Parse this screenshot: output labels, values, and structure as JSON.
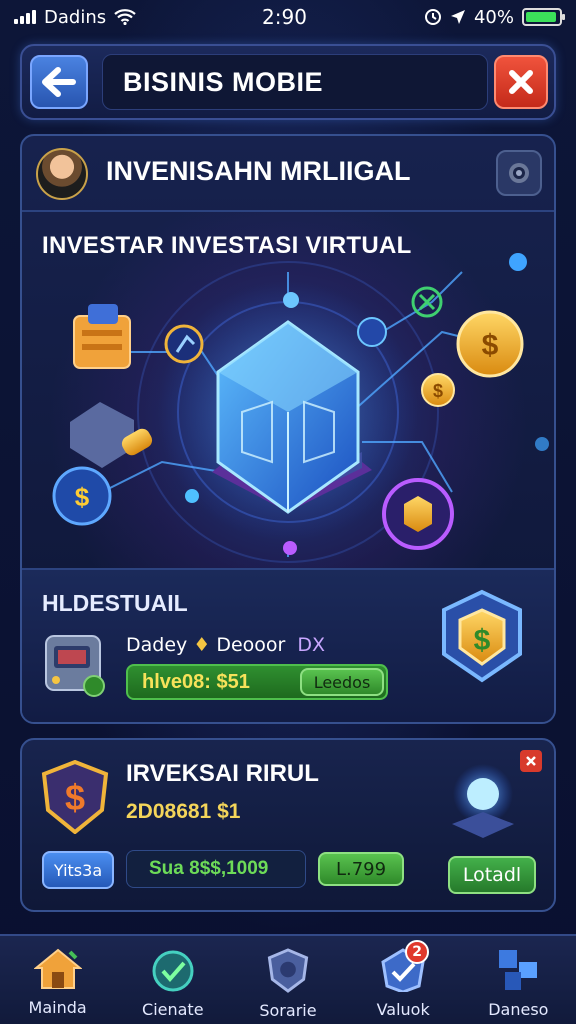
{
  "status_bar": {
    "carrier": "Dadins",
    "time": "2:90",
    "battery": "40%"
  },
  "header": {
    "title": "BISINIS MOBIE"
  },
  "main_card": {
    "title": "INVENISAHN MRLIIGAL",
    "hero_title": "INVESTAR INVESTASI VIRTUAL",
    "section": {
      "title": "HLDESTUAIL",
      "label": "Dadey",
      "label2": "Deooor",
      "label3": "DX",
      "value": "hlve08: $51",
      "button": "Leedos"
    }
  },
  "second_card": {
    "title": "IRVEKSAI RIRUL",
    "subtitle": "2D08681 $1",
    "chip": "Yits3a",
    "value": "Sua 8$$,1009",
    "small_button": "L.799",
    "action_button": "Lotadl"
  },
  "nav": [
    {
      "label": "Mainda",
      "icon": "home-icon"
    },
    {
      "label": "Cienate",
      "icon": "check-icon"
    },
    {
      "label": "Sorarie",
      "icon": "shield-icon"
    },
    {
      "label": "Valuok",
      "icon": "task-icon",
      "badge": "2"
    },
    {
      "label": "Daneso",
      "icon": "grid-icon"
    }
  ],
  "colors": {
    "accent": "#4a82e0",
    "green": "#4fbf4c",
    "red": "#e0382c",
    "gold": "#f4d55a"
  }
}
